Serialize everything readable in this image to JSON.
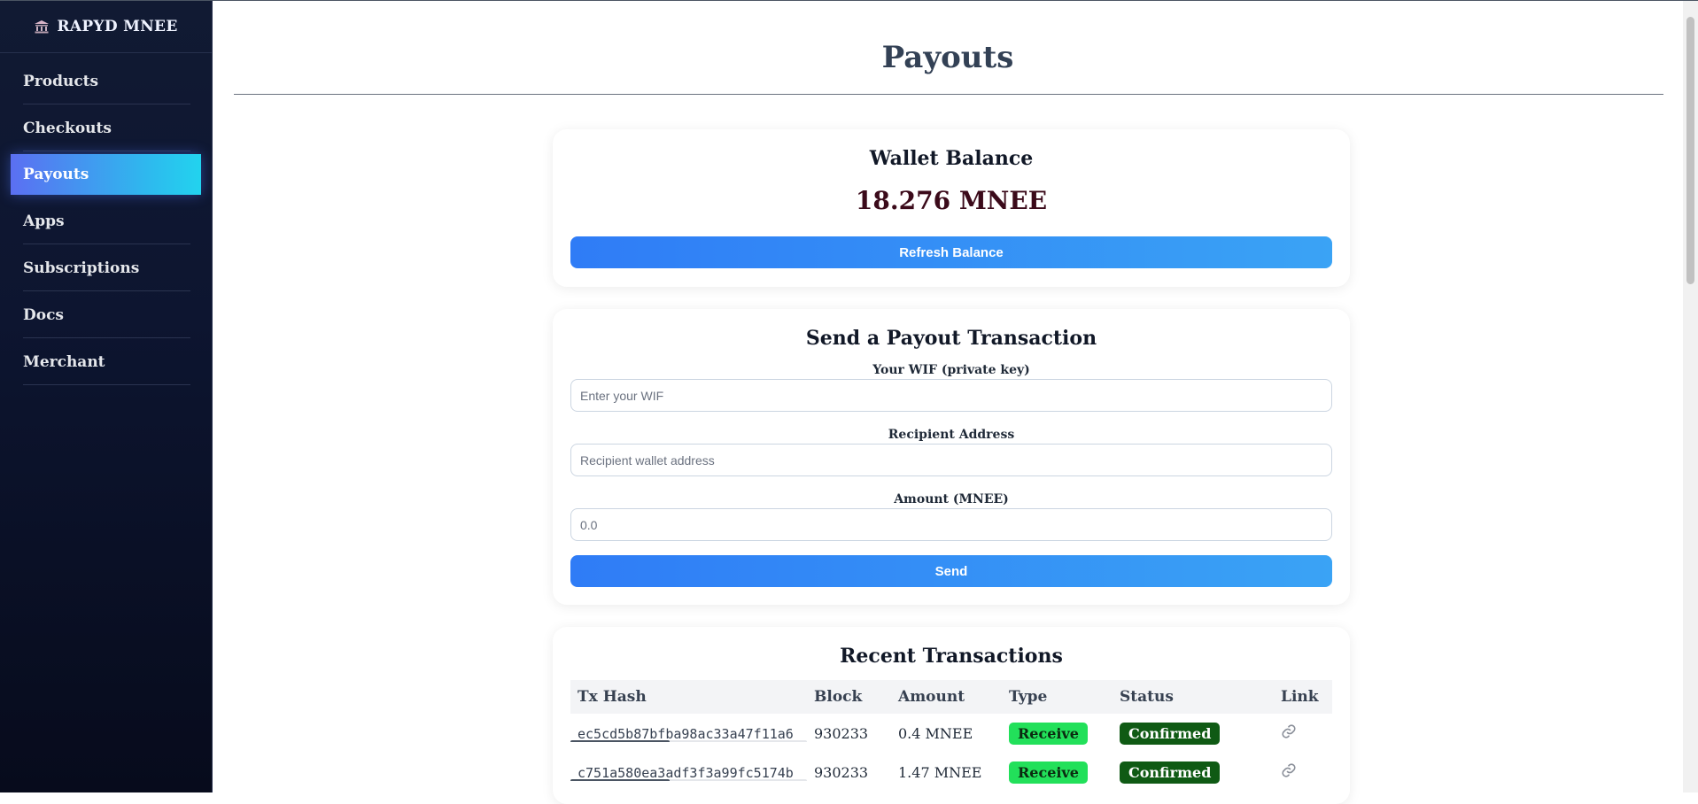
{
  "sidebar": {
    "brand": "RAPYD MNEE",
    "items": [
      {
        "label": "Products"
      },
      {
        "label": "Checkouts"
      },
      {
        "label": "Payouts"
      },
      {
        "label": "Apps"
      },
      {
        "label": "Subscriptions"
      },
      {
        "label": "Docs"
      },
      {
        "label": "Merchant"
      }
    ],
    "active": "Payouts"
  },
  "page": {
    "title": "Payouts"
  },
  "balance": {
    "title": "Wallet Balance",
    "amount": "18.276 MNEE",
    "refresh_label": "Refresh Balance"
  },
  "payout": {
    "title": "Send a Payout Transaction",
    "wif_label": "Your WIF (private key)",
    "wif_placeholder": "Enter your WIF",
    "recipient_label": "Recipient Address",
    "recipient_placeholder": "Recipient wallet address",
    "amount_label": "Amount (MNEE)",
    "amount_placeholder": "0.0",
    "send_label": "Send"
  },
  "transactions": {
    "title": "Recent Transactions",
    "columns": [
      "Tx Hash",
      "Block",
      "Amount",
      "Type",
      "Status",
      "Link"
    ],
    "rows": [
      {
        "hash": "ec5cd5b87bfba98ac33a47f11a6",
        "block": "930233",
        "amount": "0.4 MNEE",
        "type": "Receive",
        "status": "Confirmed"
      },
      {
        "hash": "c751a580ea3adf3f3a99fc5174b",
        "block": "930233",
        "amount": "1.47 MNEE",
        "type": "Receive",
        "status": "Confirmed"
      }
    ]
  },
  "colors": {
    "accent_gradient_start": "#2f7cf6",
    "accent_gradient_end": "#3aa3f5",
    "receive_badge": "#22e05a",
    "confirmed_badge": "#0f5a14",
    "sidebar_bg": "#0d1530"
  },
  "icons": {
    "brand": "bank-icon",
    "tx_link": "link-icon"
  }
}
